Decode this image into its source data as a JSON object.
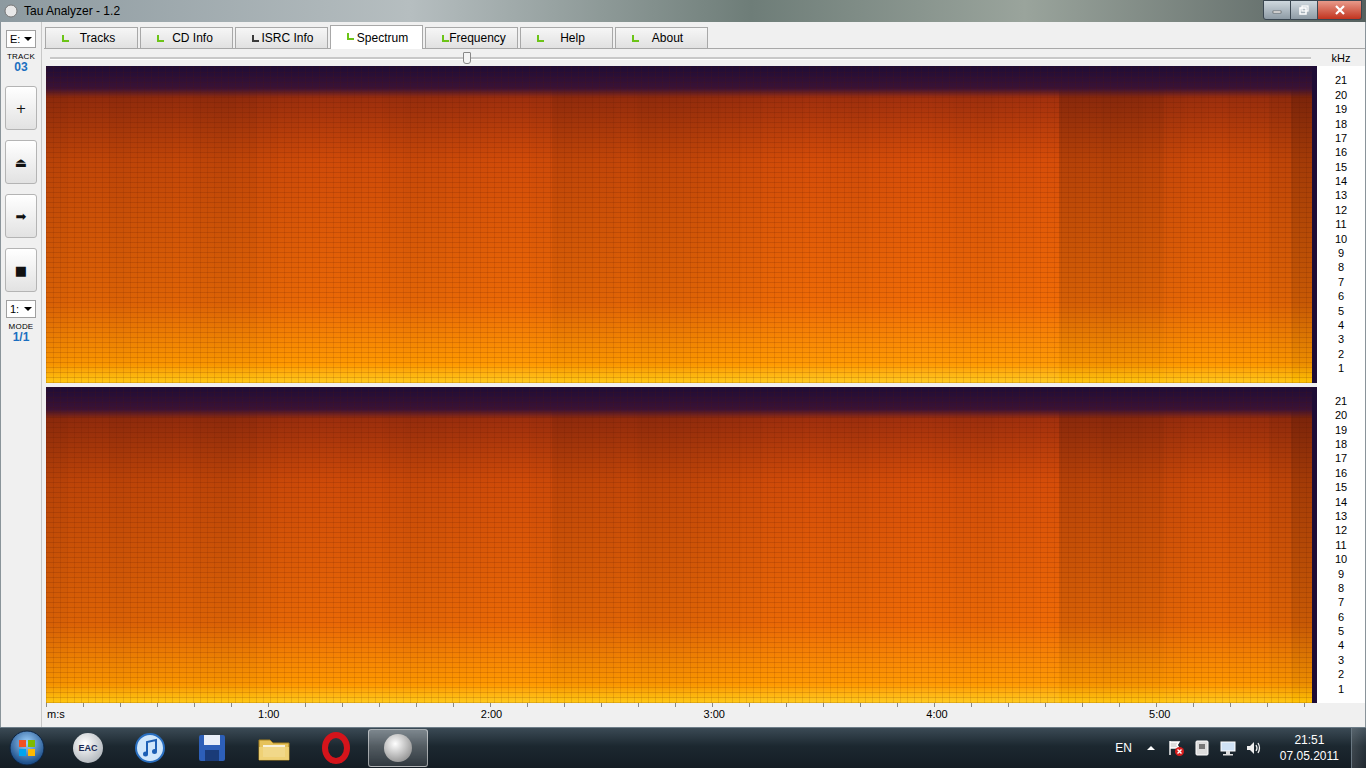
{
  "window": {
    "title": "Tau Analyzer - 1.2"
  },
  "toolbar": {
    "drive": "E:",
    "track_label": "TRACK",
    "track": "03",
    "buttons": [
      "+",
      "⏏",
      "➡",
      "■"
    ],
    "mode_select": "1:",
    "mode_label": "MODE",
    "mode": "1/1"
  },
  "tabs": [
    {
      "label": "Tracks",
      "selected": false,
      "color": "#6cc417"
    },
    {
      "label": "CD Info",
      "selected": false,
      "color": "#6cc417"
    },
    {
      "label": "ISRC Info",
      "selected": false,
      "color": "#3a3a3a"
    },
    {
      "label": "Spectrum",
      "selected": true,
      "color": "#6cc417"
    },
    {
      "label": "Frequency",
      "selected": false,
      "color": "#6cc417"
    },
    {
      "label": "Help",
      "selected": false,
      "color": "#6cc417"
    },
    {
      "label": "About",
      "selected": false,
      "color": "#6cc417"
    }
  ],
  "position": {
    "level": 0.33
  },
  "spectrum": {
    "freq_unit": "kHz",
    "freq_ticks": [
      "21",
      "20",
      "19",
      "18",
      "17",
      "16",
      "15",
      "14",
      "13",
      "12",
      "11",
      "10",
      "9",
      "8",
      "7",
      "6",
      "5",
      "4",
      "3",
      "2",
      "1"
    ],
    "time_unit": "m:s",
    "time_ticks": [
      "1:00",
      "2:00",
      "3:00",
      "4:00",
      "5:00"
    ],
    "channels": [
      {
        "levels": [
          0.55,
          0.6,
          0.62,
          0.58,
          0.6,
          0.62,
          0.65,
          0.6,
          0.58,
          0.62,
          0.7,
          0.75,
          0.78,
          0.8,
          0.76,
          0.78,
          0.74,
          0.7,
          0.72,
          0.75,
          0.78,
          0.8,
          0.82,
          0.78,
          0.6,
          0.62,
          0.64,
          0.66,
          0.6,
          0.62,
          0.64,
          0.68,
          0.72,
          0.76,
          0.8,
          0.82,
          0.85,
          0.82,
          0.8,
          0.84,
          0.86,
          0.88,
          0.85,
          0.82,
          0.8,
          0.84,
          0.86,
          0.88,
          0.5,
          0.52,
          0.48,
          0.5,
          0.55,
          0.7,
          0.75,
          0.78,
          0.74,
          0.72,
          0.6,
          0.3
        ]
      },
      {
        "levels": [
          0.52,
          0.58,
          0.6,
          0.56,
          0.58,
          0.6,
          0.63,
          0.58,
          0.56,
          0.6,
          0.68,
          0.73,
          0.76,
          0.78,
          0.74,
          0.76,
          0.72,
          0.68,
          0.7,
          0.73,
          0.76,
          0.78,
          0.8,
          0.76,
          0.58,
          0.6,
          0.62,
          0.64,
          0.58,
          0.6,
          0.62,
          0.66,
          0.7,
          0.74,
          0.78,
          0.8,
          0.83,
          0.8,
          0.78,
          0.82,
          0.84,
          0.86,
          0.83,
          0.8,
          0.78,
          0.82,
          0.84,
          0.86,
          0.52,
          0.55,
          0.5,
          0.52,
          0.56,
          0.68,
          0.73,
          0.76,
          0.72,
          0.7,
          0.58,
          0.3
        ]
      }
    ]
  },
  "taskbar": {
    "apps": [
      {
        "kind": "eac",
        "label": "EAC",
        "selected": false
      },
      {
        "kind": "itunes",
        "selected": false
      },
      {
        "kind": "floppy",
        "selected": false
      },
      {
        "kind": "folder",
        "selected": false
      },
      {
        "kind": "opera",
        "selected": false
      },
      {
        "kind": "sphere",
        "selected": true
      }
    ],
    "language": "EN",
    "tray": [
      {
        "kind": "action-center"
      },
      {
        "kind": "device"
      },
      {
        "kind": "network"
      },
      {
        "kind": "volume"
      }
    ],
    "time": "21:51",
    "date": "07.05.2011"
  }
}
